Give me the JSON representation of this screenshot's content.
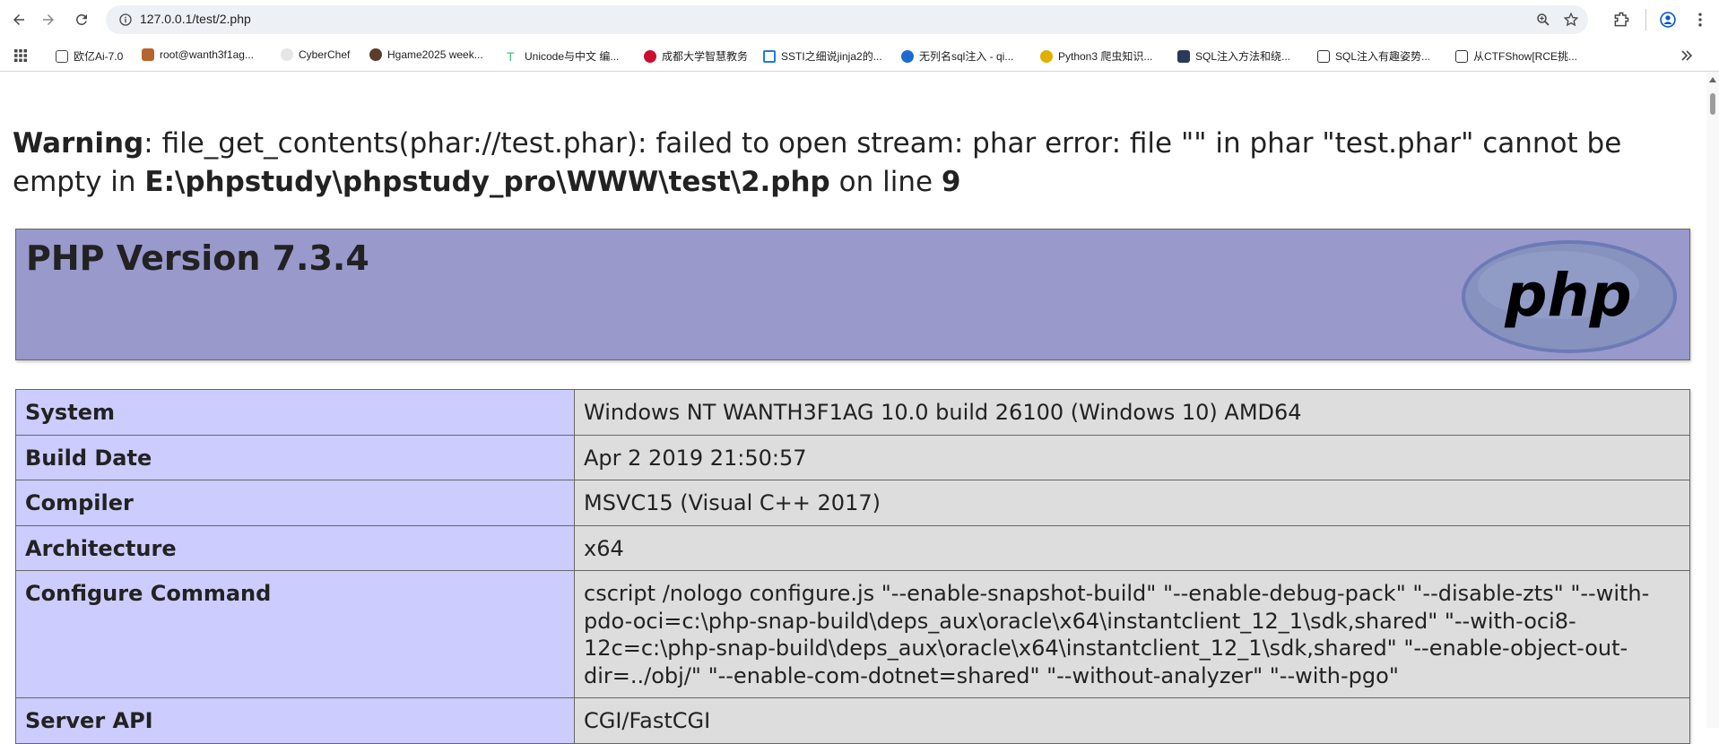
{
  "browser": {
    "url": "127.0.0.1/test/2.php",
    "icons": [
      "back-icon",
      "forward-icon",
      "reload-icon",
      "info-icon",
      "zoom-icon",
      "star-icon",
      "extensions-icon",
      "profile-icon",
      "menu-icon",
      "apps-icon",
      "more-bookmarks-icon"
    ]
  },
  "bookmarks": [
    {
      "label": "欧亿Ai-7.0",
      "color": "#444444"
    },
    {
      "label": "root@wanth3f1ag...",
      "color": "#b5652f"
    },
    {
      "label": "CyberChef",
      "color": "#cccccc"
    },
    {
      "label": "Hgame2025 week...",
      "color": "#5b3b2a"
    },
    {
      "label": "Unicode与中文 编...",
      "color": "#3cbf7d"
    },
    {
      "label": "成都大学智慧教务",
      "color": "#c8102e"
    },
    {
      "label": "SSTI之细说jinja2的...",
      "color": "#1f7ae0"
    },
    {
      "label": "无列名sql注入 - qi...",
      "color": "#1b6bd1"
    },
    {
      "label": "Python3 爬虫知识...",
      "color": "#e0b000"
    },
    {
      "label": "SQL注入方法和绕...",
      "color": "#2a3a5a"
    },
    {
      "label": "SQL注入有趣姿势...",
      "color": "#333333"
    },
    {
      "label": "从CTFShow[RCE挑...",
      "color": "#333333"
    }
  ],
  "warning": {
    "label": "Warning",
    "message": ": file_get_contents(phar://test.phar): failed to open stream: phar error: file \"\" in phar \"test.phar\" cannot be empty in ",
    "file": "E:\\phpstudy\\phpstudy_pro\\WWW\\test\\2.php",
    "on_line": " on line ",
    "line": "9"
  },
  "header": {
    "title": "PHP Version 7.3.4",
    "logo_text": "php",
    "colors": {
      "header_bg": "#9999cc",
      "key_bg": "#ccccff",
      "value_bg": "#dddddd",
      "logo_bg": "#8892bf"
    }
  },
  "info_rows": [
    {
      "key": "System",
      "value": "Windows NT WANTH3F1AG 10.0 build 26100 (Windows 10) AMD64"
    },
    {
      "key": "Build Date",
      "value": "Apr 2 2019 21:50:57"
    },
    {
      "key": "Compiler",
      "value": "MSVC15 (Visual C++ 2017)"
    },
    {
      "key": "Architecture",
      "value": "x64"
    },
    {
      "key": "Configure Command",
      "value": "cscript /nologo configure.js \"--enable-snapshot-build\" \"--enable-debug-pack\" \"--disable-zts\" \"--with-pdo-oci=c:\\php-snap-build\\deps_aux\\oracle\\x64\\instantclient_12_1\\sdk,shared\" \"--with-oci8-12c=c:\\php-snap-build\\deps_aux\\oracle\\x64\\instantclient_12_1\\sdk,shared\" \"--enable-object-out-dir=../obj/\" \"--enable-com-dotnet=shared\" \"--without-analyzer\" \"--with-pgo\""
    },
    {
      "key": "Server API",
      "value": "CGI/FastCGI"
    }
  ]
}
